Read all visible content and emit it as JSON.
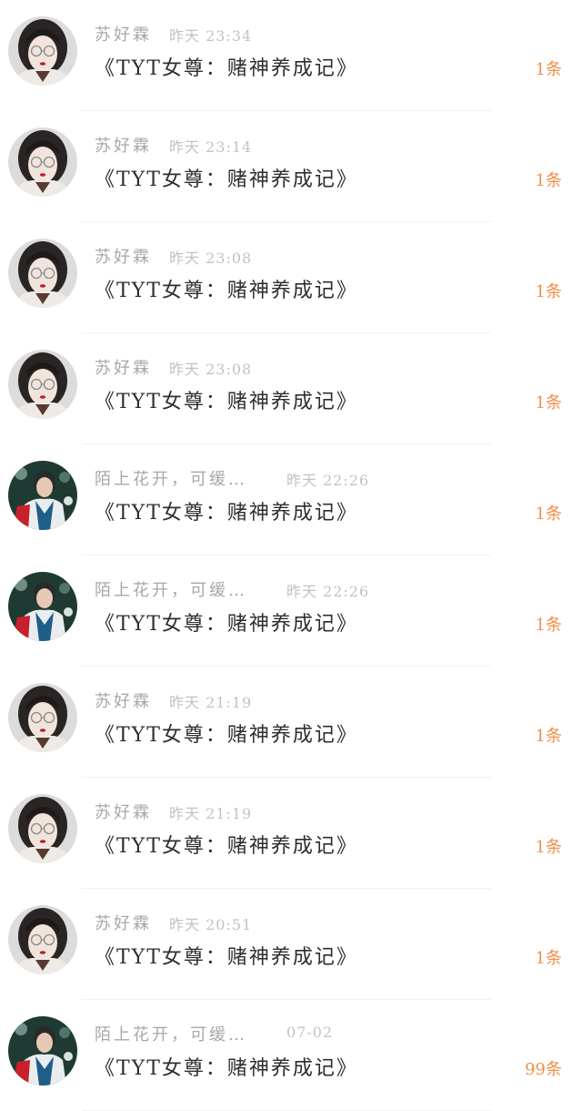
{
  "messages": [
    {
      "name": "苏好霖",
      "time": "昨天 23:34",
      "title": "《TYT女尊：赌神养成记》",
      "count": "1条",
      "avatar_icon": "girl-glasses-avatar-icon"
    },
    {
      "name": "苏好霖",
      "time": "昨天 23:14",
      "title": "《TYT女尊：赌神养成记》",
      "count": "1条",
      "avatar_icon": "girl-glasses-avatar-icon"
    },
    {
      "name": "苏好霖",
      "time": "昨天 23:08",
      "title": "《TYT女尊：赌神养成记》",
      "count": "1条",
      "avatar_icon": "girl-glasses-avatar-icon"
    },
    {
      "name": "苏好霖",
      "time": "昨天 23:08",
      "title": "《TYT女尊：赌神养成记》",
      "count": "1条",
      "avatar_icon": "girl-glasses-avatar-icon"
    },
    {
      "name": "陌上花开，可缓…",
      "time": "昨天 22:26",
      "title": "《TYT女尊：赌神养成记》",
      "count": "1条",
      "avatar_icon": "boy-jacket-avatar-icon"
    },
    {
      "name": "陌上花开，可缓…",
      "time": "昨天 22:26",
      "title": "《TYT女尊：赌神养成记》",
      "count": "1条",
      "avatar_icon": "boy-jacket-avatar-icon"
    },
    {
      "name": "苏好霖",
      "time": "昨天 21:19",
      "title": "《TYT女尊：赌神养成记》",
      "count": "1条",
      "avatar_icon": "girl-glasses-avatar-icon"
    },
    {
      "name": "苏好霖",
      "time": "昨天 21:19",
      "title": "《TYT女尊：赌神养成记》",
      "count": "1条",
      "avatar_icon": "girl-glasses-avatar-icon"
    },
    {
      "name": "苏好霖",
      "time": "昨天 20:51",
      "title": "《TYT女尊：赌神养成记》",
      "count": "1条",
      "avatar_icon": "girl-glasses-avatar-icon"
    },
    {
      "name": "陌上花开，可缓…",
      "time": "07-02",
      "title": "《TYT女尊：赌神养成记》",
      "count": "99条",
      "avatar_icon": "boy-jacket-avatar-icon"
    }
  ],
  "colors": {
    "count_accent": "#f08f4a",
    "name_gray": "#a7a7a7",
    "time_gray": "#c2c2c2",
    "title_dark": "#2e2e2e"
  }
}
